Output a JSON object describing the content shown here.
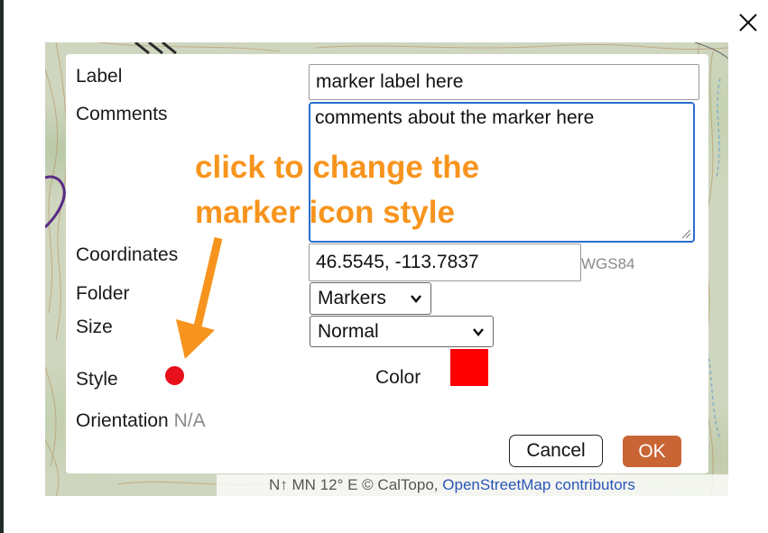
{
  "form": {
    "label_caption": "Label",
    "label_value": "marker label here",
    "comments_caption": "Comments",
    "comments_value": "comments about the marker here",
    "coordinates_caption": "Coordinates",
    "coordinates_value": "46.5545, -113.7837",
    "datum": "WGS84",
    "folder_caption": "Folder",
    "folder_value": "Markers",
    "size_caption": "Size",
    "size_value": "Normal",
    "style_caption": "Style",
    "style_color": "#e8101a",
    "color_caption": "Color",
    "color_value": "#ff0000",
    "orientation_caption": "Orientation",
    "orientation_value": "N/A"
  },
  "annotation": {
    "line1": "click to change the",
    "line2": "marker icon style",
    "color": "#f7941d"
  },
  "buttons": {
    "cancel": "Cancel",
    "ok": "OK"
  },
  "attribution": {
    "declination": "N↑ MN 12° E",
    "copyright": "© CalTopo,",
    "osm_link": "OpenStreetMap contributors"
  },
  "icons": {
    "close": "close-icon",
    "chevron": "chevron-down-icon",
    "arrow": "annotation-arrow"
  }
}
